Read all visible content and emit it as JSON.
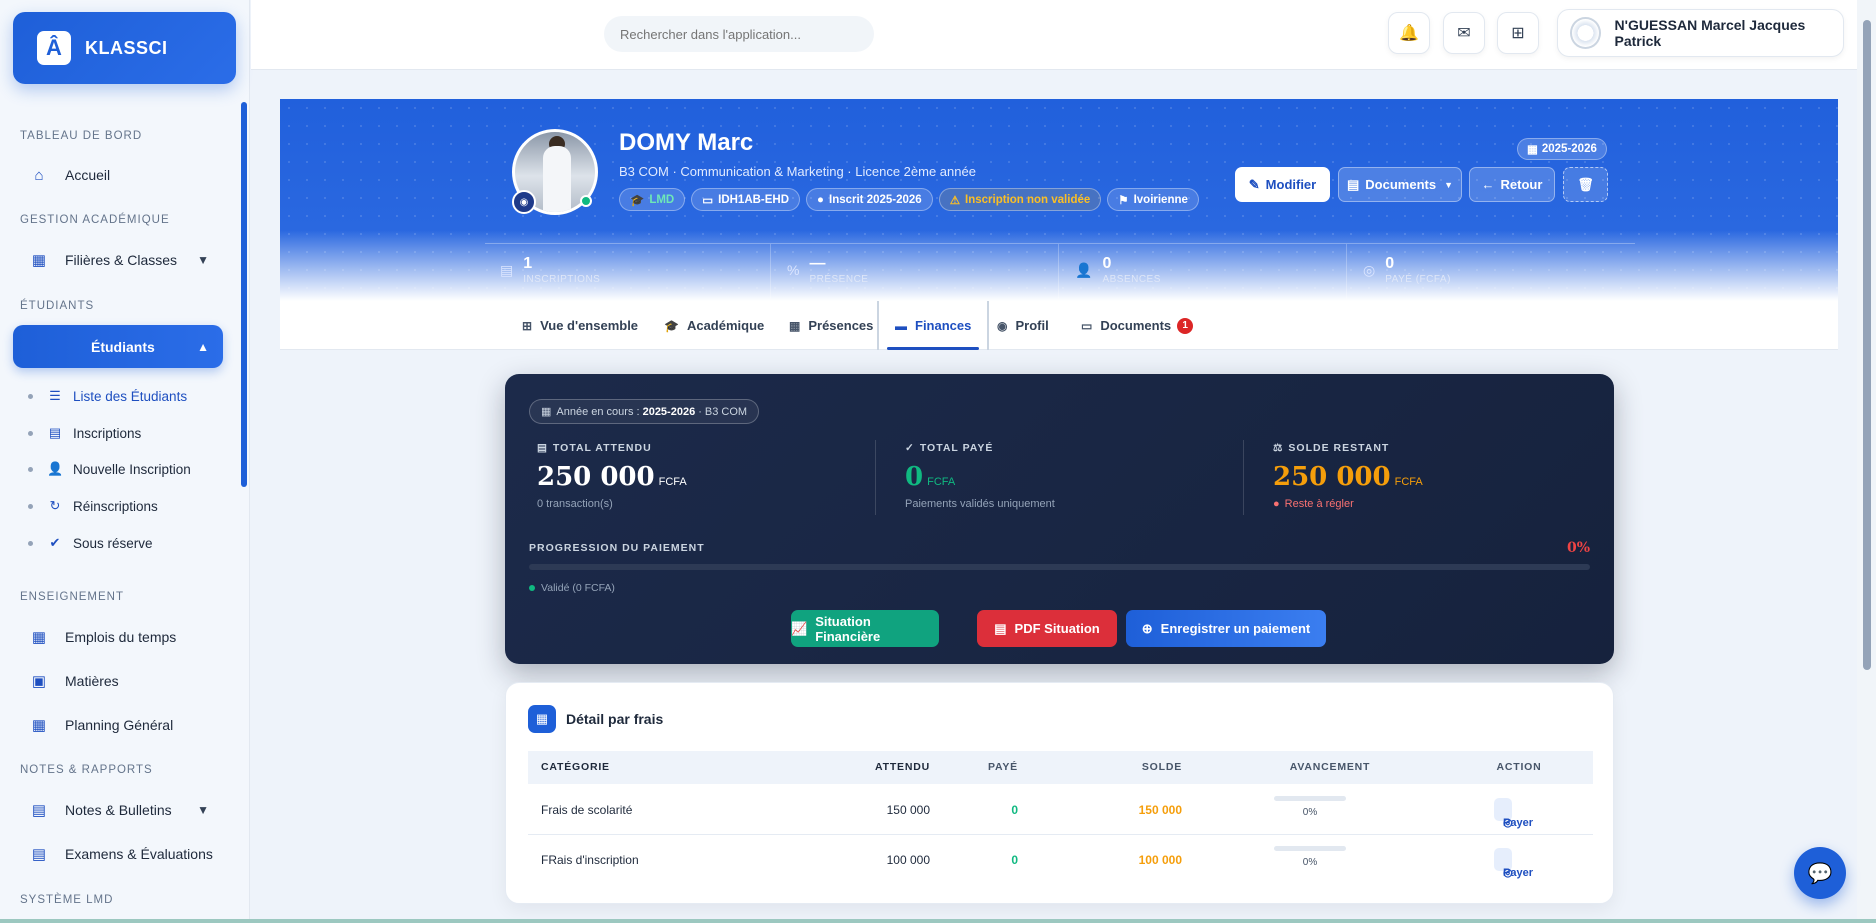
{
  "brand": {
    "logo": "Â",
    "name": "KLASSCI"
  },
  "sidebar": {
    "sections": [
      "TABLEAU DE BORD",
      "GESTION ACADÉMIQUE",
      "ÉTUDIANTS",
      "ENSEIGNEMENT",
      "NOTES & RAPPORTS",
      "SYSTÈME LMD"
    ],
    "items": [
      {
        "label": "Accueil",
        "icon": "home-icon"
      },
      {
        "label": "Filières & Classes",
        "icon": "building-icon"
      },
      {
        "label": "Étudiants",
        "icon": "students-icon"
      },
      {
        "label": "Emplois du temps",
        "icon": "calendar-icon"
      },
      {
        "label": "Matières",
        "icon": "book-icon"
      },
      {
        "label": "Planning Général",
        "icon": "calendar-check-icon"
      },
      {
        "label": "Notes & Bulletins",
        "icon": "file-icon"
      },
      {
        "label": "Examens & Évaluations",
        "icon": "clipboard-icon"
      }
    ],
    "sub_items": [
      {
        "label": "Liste des Étudiants",
        "icon": "list-icon"
      },
      {
        "label": "Inscriptions",
        "icon": "clipboard-icon"
      },
      {
        "label": "Nouvelle Inscription",
        "icon": "user-plus-icon"
      },
      {
        "label": "Réinscriptions",
        "icon": "refresh-icon"
      },
      {
        "label": "Sous réserve",
        "icon": "clipboard-check-icon"
      }
    ]
  },
  "header": {
    "search_placeholder": "Rechercher dans l'application...",
    "user_name": "N'GUESSAN Marcel Jacques Patrick"
  },
  "student": {
    "name": "DOMY Marc",
    "subtitle": "B3 COM · Communication & Marketing · Licence 2ème année",
    "chips": [
      "LMD",
      "IDH1AB-EHD",
      "Inscrit 2025-2026",
      "Inscription non validée",
      "Ivoirienne"
    ],
    "year_badge": "2025-2026",
    "actions": {
      "edit": "Modifier",
      "documents": "Documents",
      "back": "Retour"
    }
  },
  "stats": [
    {
      "value": "1",
      "label": "INSCRIPTIONS"
    },
    {
      "value": "—",
      "label": "PRÉSENCE"
    },
    {
      "value": "0",
      "label": "ABSENCES"
    },
    {
      "value": "0",
      "label": "PAYÉ (FCFA)"
    }
  ],
  "tabs": [
    {
      "label": "Vue d'ensemble"
    },
    {
      "label": "Académique"
    },
    {
      "label": "Présences"
    },
    {
      "label": "Finances"
    },
    {
      "label": "Profil"
    },
    {
      "label": "Documents",
      "badge": "1"
    }
  ],
  "finance": {
    "year_label": "Année en cours :",
    "year_value": "2025-2026",
    "year_class": "· B3 COM",
    "total_attendu": {
      "label": "TOTAL ATTENDU",
      "value": "250 000",
      "currency": "FCFA",
      "note": "0 transaction(s)"
    },
    "total_paye": {
      "label": "TOTAL PAYÉ",
      "value": "0",
      "currency": "FCFA",
      "note": "Paiements validés uniquement"
    },
    "solde": {
      "label": "SOLDE RESTANT",
      "value": "250 000",
      "currency": "FCFA",
      "note": "Reste à régler"
    },
    "progress_label": "PROGRESSION DU PAIEMENT",
    "progress_pct": "0%",
    "progress_value": 0,
    "legend": "Validé (0 FCFA)",
    "buttons": {
      "situation": "Situation Financière",
      "pdf": "PDF Situation",
      "record": "Enregistrer un paiement"
    }
  },
  "detail": {
    "title": "Détail par frais",
    "columns": [
      "CATÉGORIE",
      "ATTENDU",
      "PAYÉ",
      "SOLDE",
      "AVANCEMENT",
      "ACTION"
    ],
    "rows": [
      {
        "categorie": "Frais de scolarité",
        "attendu": "150 000",
        "paye": "0",
        "solde": "150 000",
        "avancement": "0%",
        "action": "Payer"
      },
      {
        "categorie": "FRais d'inscription",
        "attendu": "100 000",
        "paye": "0",
        "solde": "100 000",
        "avancement": "0%",
        "action": "Payer"
      }
    ]
  },
  "colors": {
    "primary": "#1e5fd8",
    "success": "#10b981",
    "warning": "#f59e0b",
    "danger": "#dc2626",
    "dark": "#1c2a4a"
  }
}
